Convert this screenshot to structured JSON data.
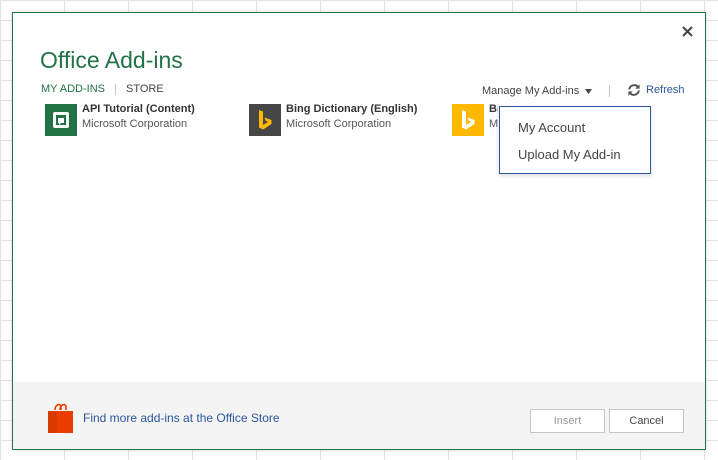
{
  "dialog": {
    "title": "Office Add-ins",
    "close_label": "✕"
  },
  "tabs": [
    {
      "label": "MY ADD-INS",
      "active": true
    },
    {
      "label": "STORE",
      "active": false
    }
  ],
  "manage": {
    "label": "Manage My Add-ins",
    "caret": "▼"
  },
  "refresh": {
    "label": "Refresh",
    "icon": "refresh-icon"
  },
  "addins": [
    {
      "name": "API Tutorial (Content)",
      "publisher": "Microsoft Corporation",
      "icon": "api-tutorial-icon",
      "tile_color": "#217346"
    },
    {
      "name": "Bing Dictionary (English)",
      "publisher": "Microsoft Corporation",
      "icon": "bing-icon",
      "tile_color": "#464646"
    },
    {
      "name": "Bi",
      "publisher": "M",
      "icon": "bing-icon",
      "tile_color": "#ffb900"
    }
  ],
  "dropdown": {
    "items": [
      "My Account",
      "Upload My Add-in"
    ]
  },
  "footer": {
    "store_link": "Find more add-ins at the Office Store",
    "store_icon": "office-store-bag-icon",
    "insert_label": "Insert",
    "cancel_label": "Cancel"
  },
  "colors": {
    "accent": "#217346",
    "link": "#2b579a",
    "store_orange": "#eb3c00"
  }
}
